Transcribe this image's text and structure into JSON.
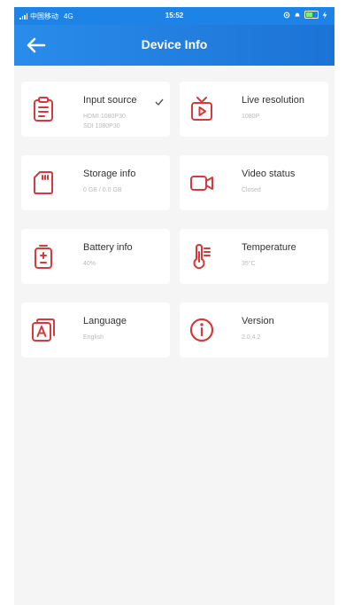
{
  "status_bar": {
    "carrier": "中国移动",
    "network": "4G",
    "time": "15:52"
  },
  "header": {
    "title": "Device Info",
    "back_icon": "arrow-left-icon"
  },
  "accent_color": "#d63a3a",
  "header_color": "#1d7ee0",
  "cards": {
    "input_source": {
      "label": "Input source",
      "value_1": "HDMI 1080P30",
      "value_2": "SDI 1080P30",
      "icon": "clipboard-icon",
      "selected": true
    },
    "live_resolution": {
      "label": "Live resolution",
      "value": "1080P",
      "icon": "tv-play-icon"
    },
    "storage_info": {
      "label": "Storage info",
      "value": "0 GB / 0.0 GB",
      "icon": "sd-card-icon"
    },
    "video_status": {
      "label": "Video status",
      "value": "Closed",
      "icon": "video-camera-icon"
    },
    "battery_info": {
      "label": "Battery info",
      "value": "40%",
      "icon": "battery-icon"
    },
    "temperature": {
      "label": "Temperature",
      "value": "35°C",
      "icon": "thermometer-icon"
    },
    "language": {
      "label": "Language",
      "value": "English",
      "icon": "language-a-icon"
    },
    "version": {
      "label": "Version",
      "value": "2.0.4.2",
      "icon": "info-icon"
    }
  }
}
